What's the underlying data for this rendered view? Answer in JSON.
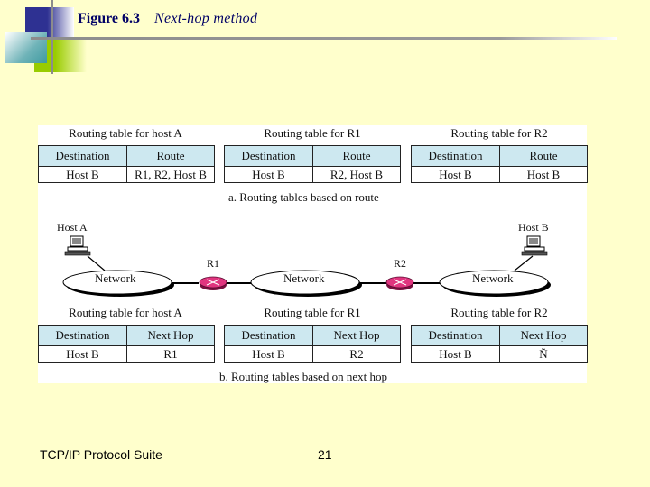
{
  "slide": {
    "figure_number": "Figure 6.3",
    "figure_caption": "Next-hop method",
    "footer_left": "TCP/IP Protocol Suite",
    "page_number": "21"
  },
  "colors": {
    "background": "#FFFFCC",
    "title": "#000066",
    "table_header": "#CDE8F0",
    "router": "#E0357F"
  },
  "route_tables": {
    "caption": "a. Routing tables based on route",
    "tables": [
      {
        "title": "Routing table for host A",
        "headers": [
          "Destination",
          "Route"
        ],
        "rows": [
          [
            "Host B",
            "R1, R2, Host B"
          ]
        ]
      },
      {
        "title": "Routing table for R1",
        "headers": [
          "Destination",
          "Route"
        ],
        "rows": [
          [
            "Host B",
            "R2, Host B"
          ]
        ]
      },
      {
        "title": "Routing table for R2",
        "headers": [
          "Destination",
          "Route"
        ],
        "rows": [
          [
            "Host B",
            "Host B"
          ]
        ]
      }
    ]
  },
  "network": {
    "host_a": "Host A",
    "host_b": "Host B",
    "networks": [
      "Network",
      "Network",
      "Network"
    ],
    "routers": [
      "R1",
      "R2"
    ]
  },
  "nexthop_tables": {
    "caption": "b. Routing tables based on next hop",
    "tables": [
      {
        "title": "Routing table for host A",
        "headers": [
          "Destination",
          "Next Hop"
        ],
        "rows": [
          [
            "Host B",
            "R1"
          ]
        ]
      },
      {
        "title": "Routing table for R1",
        "headers": [
          "Destination",
          "Next Hop"
        ],
        "rows": [
          [
            "Host B",
            "R2"
          ]
        ]
      },
      {
        "title": "Routing table for R2",
        "headers": [
          "Destination",
          "Next Hop"
        ],
        "rows": [
          [
            "Host B",
            "Ñ"
          ]
        ]
      }
    ]
  }
}
